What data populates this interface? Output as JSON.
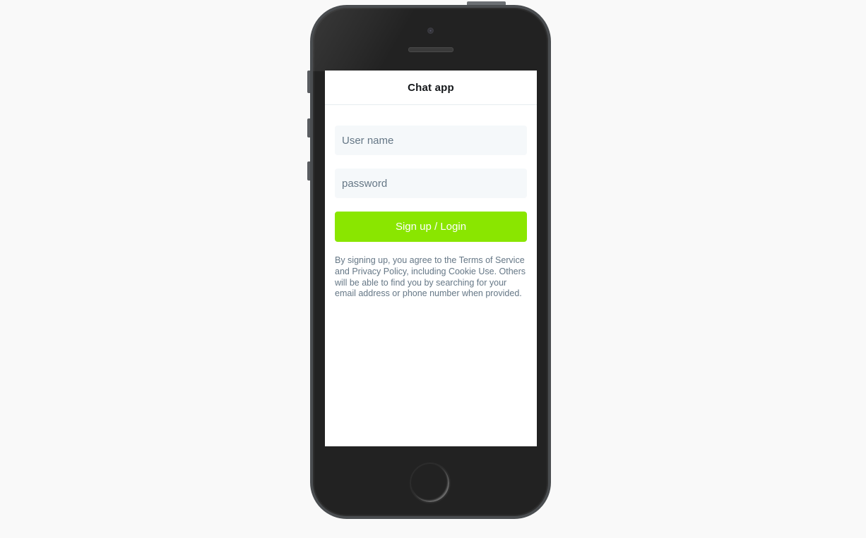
{
  "app": {
    "title": "Chat app"
  },
  "login_form": {
    "username_placeholder": "User name",
    "username_value": "",
    "password_placeholder": "password",
    "password_value": "",
    "submit_label": "Sign up / Login",
    "terms_text": "By signing up, you agree to the Terms of Service and Privacy Policy, including Cookie Use. Others will be able to find you by searching for your email address or phone number when provided."
  },
  "colors": {
    "accent": "#8ae600",
    "page_background": "#f9f9f9",
    "device_body": "#222222",
    "input_background": "#f5f8fa",
    "muted_text": "#657786"
  },
  "icons": {
    "camera": "front-camera-icon",
    "speaker": "earpiece-speaker-icon",
    "home": "home-button-icon"
  }
}
